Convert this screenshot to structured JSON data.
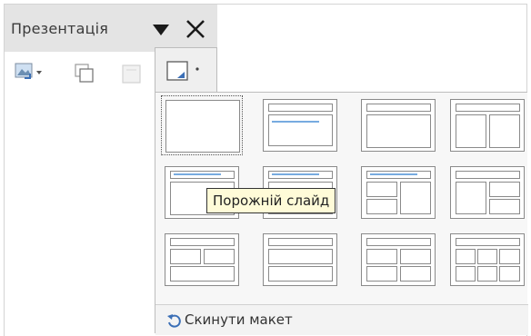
{
  "panel": {
    "title": "Презентація"
  },
  "toolbar": {
    "buttons": [
      {
        "icon": "insert-image-icon",
        "has_dropdown": true
      },
      {
        "icon": "duplicate-slide-icon"
      },
      {
        "icon": "delete-slide-icon",
        "disabled": true
      },
      {
        "icon": "slide-layout-icon",
        "has_dropdown": true,
        "active": true
      }
    ]
  },
  "layouts": {
    "items": [
      {
        "id": "blank",
        "selected": true
      },
      {
        "id": "title-content"
      },
      {
        "id": "title-content-box"
      },
      {
        "id": "title-two-columns"
      },
      {
        "id": "centered-text"
      },
      {
        "id": "title-2-content-small"
      },
      {
        "id": "title-content-and-2"
      },
      {
        "id": "title-2-content-and"
      },
      {
        "id": "title-2-content-over"
      },
      {
        "id": "title-content-over"
      },
      {
        "id": "title-4-content"
      },
      {
        "id": "title-6-content"
      }
    ],
    "tooltip": "Порожній слайд",
    "reset_label": "Скинути макет"
  },
  "colors": {
    "titlebar": "#e4e4e4",
    "popup_bg": "#f7f7f7",
    "tooltip_bg": "#fffbd8",
    "thumb_stroke": "#8a8a8a",
    "accent": "#4a8fd6"
  }
}
